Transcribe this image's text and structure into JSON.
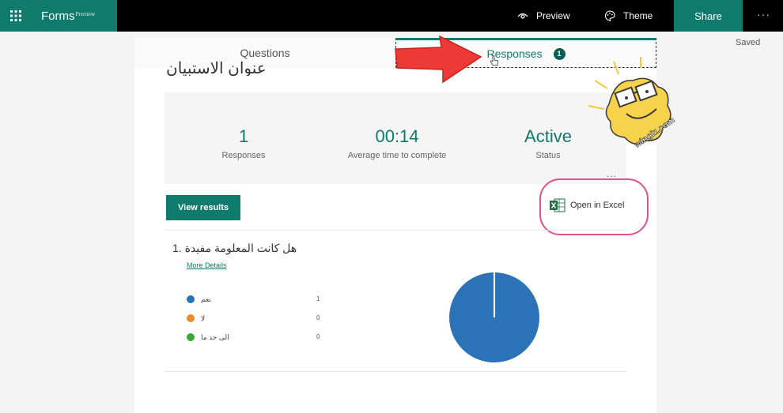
{
  "app": {
    "brand": "Forms",
    "brand_suffix": "Preview",
    "saved": "Saved"
  },
  "toolbar": {
    "preview_label": "Preview",
    "theme_label": "Theme",
    "share_label": "Share",
    "more_label": "···"
  },
  "tabs": [
    {
      "label": "Questions"
    },
    {
      "label": "Responses",
      "badge": "1"
    }
  ],
  "form": {
    "title": "عنوان الاستبيان"
  },
  "stats": [
    {
      "value": "1",
      "label": "Responses"
    },
    {
      "value": "00:14",
      "label": "Average time to complete"
    },
    {
      "value": "Active",
      "label": "Status"
    }
  ],
  "stats_more": "...",
  "actions": {
    "view_results": "View results",
    "open_excel": "Open in Excel"
  },
  "question": {
    "text": "هل كانت المعلومة مفيدة .1",
    "more_details": "More Details",
    "options": [
      {
        "label": "نعم",
        "count": "1",
        "color": "#2b72b6"
      },
      {
        "label": "لا",
        "count": "0",
        "color": "#f08a24"
      },
      {
        "label": "الى حد ما",
        "count": "0",
        "color": "#3aa53a"
      }
    ]
  },
  "chart_data": {
    "type": "pie",
    "categories": [
      "نعم",
      "لا",
      "الى حد ما"
    ],
    "values": [
      1,
      0,
      0
    ],
    "colors": [
      "#2b72b6",
      "#f08a24",
      "#3aa53a"
    ]
  },
  "watermark": "wingiz.com",
  "colors": {
    "accent": "#0f7b6c",
    "highlight_ring": "#e0528c"
  }
}
